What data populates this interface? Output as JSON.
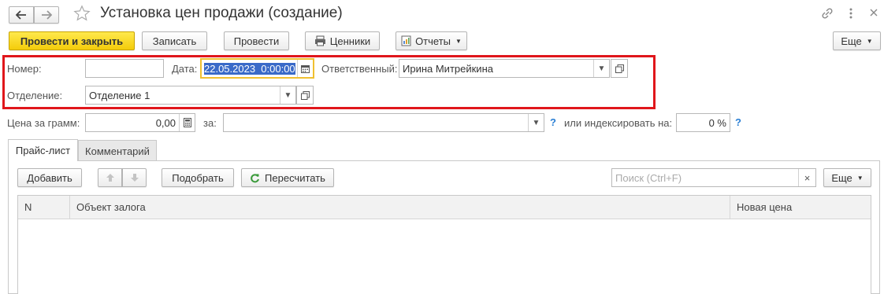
{
  "title": "Установка цен продажи (создание)",
  "toolbar": {
    "post_close": "Провести и закрыть",
    "save": "Записать",
    "post": "Провести",
    "price_tags": "Ценники",
    "reports": "Отчеты",
    "more": "Еще"
  },
  "form": {
    "number_label": "Номер:",
    "number_value": "",
    "date_label": "Дата:",
    "date_value": "22.05.2023  0:00:00",
    "responsible_label": "Ответственный:",
    "responsible_value": "Ирина Митрейкина",
    "department_label": "Отделение:",
    "department_value": "Отделение 1",
    "price_per_gram_label": "Цена за грамм:",
    "price_per_gram_value": "0,00",
    "for_label": "за:",
    "for_value": "",
    "index_label": "или индексировать на:",
    "index_value": "0 %",
    "help": "?"
  },
  "tabs": [
    {
      "label": "Прайс-лист",
      "active": true
    },
    {
      "label": "Комментарий",
      "active": false
    }
  ],
  "table_toolbar": {
    "add": "Добавить",
    "pick": "Подобрать",
    "recalc": "Пересчитать",
    "search_placeholder": "Поиск (Ctrl+F)",
    "clear": "×",
    "more": "Еще"
  },
  "table": {
    "columns": [
      "N",
      "Объект залога",
      "Новая цена"
    ],
    "rows": []
  },
  "colors": {
    "highlight_frame": "#e0161b",
    "primary_button": "#f5d01b",
    "help": "#2a7fd4",
    "date_focus": "#f0c030",
    "recalc_icon": "#3a9a3a"
  }
}
